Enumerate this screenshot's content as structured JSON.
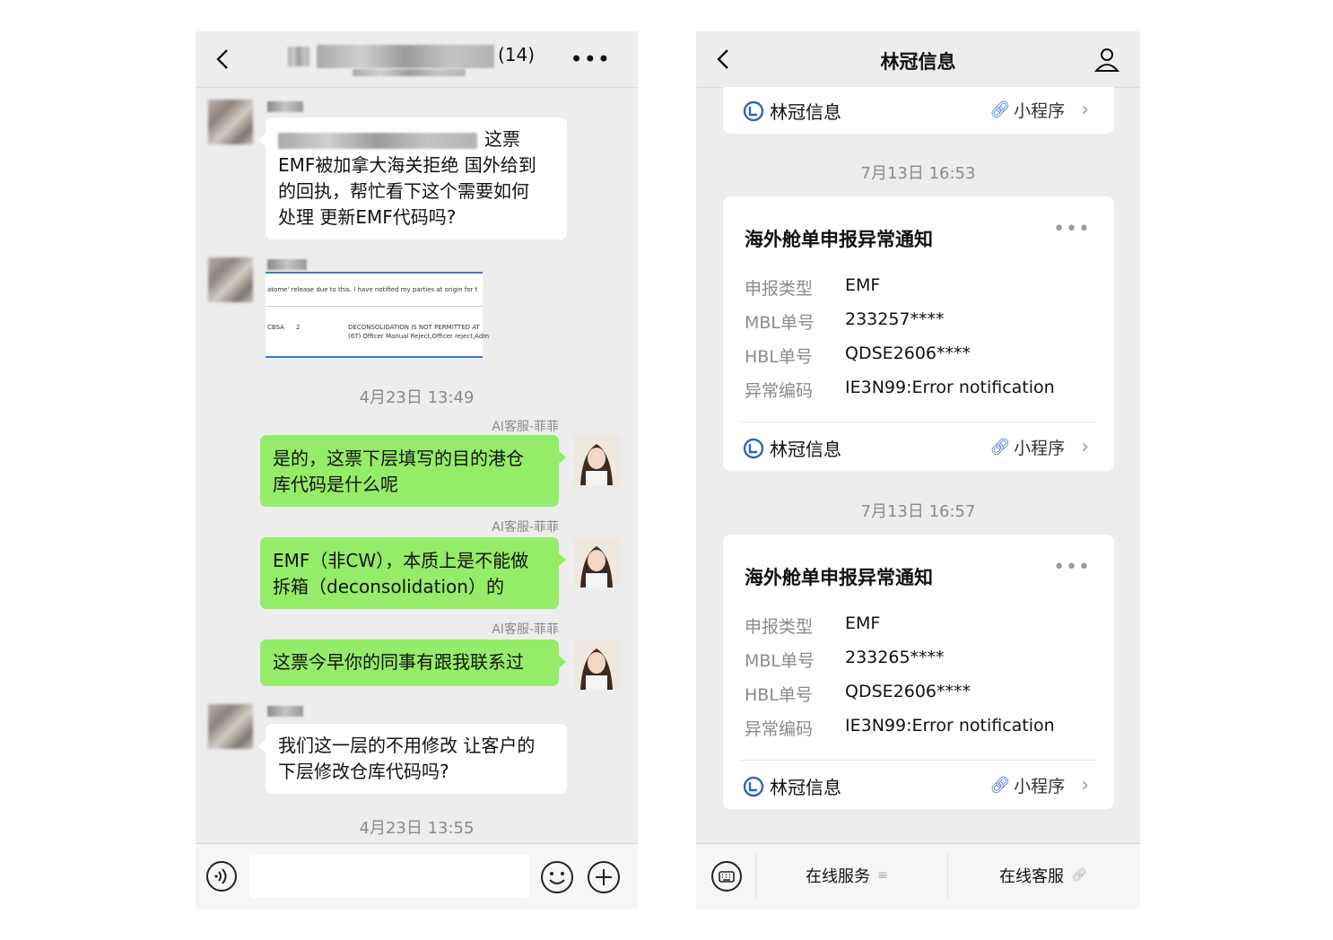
{
  "left": {
    "header": {
      "count": "(14)"
    },
    "messages": [
      {
        "type": "text-in",
        "text_lines": [
          "这票",
          "EMF被加拿大海关拒绝 国外给到",
          "的回执，帮忙看下这个需要如何",
          "处理 更新EMF代码吗?"
        ]
      },
      {
        "type": "image-in",
        "image_lines": [
          "atome' release due to this. I have notified my parties at origin for t",
          "CBSA",
          "2",
          "DECONSOLIDATION IS NOT PERMITTED AT",
          "(6T) Officer Manual Reject,Officer reject,Adm"
        ]
      },
      {
        "type": "time",
        "text": "4月23日 13:49"
      },
      {
        "type": "text-out",
        "sender": "AI客服-菲菲",
        "text_lines": [
          "是的，这票下层填写的目的港仓",
          "库代码是什么呢"
        ]
      },
      {
        "type": "text-out",
        "sender": "AI客服-菲菲",
        "text_lines": [
          "EMF（非CW），本质上是不能做",
          "拆箱（deconsolidation）的"
        ]
      },
      {
        "type": "text-out",
        "sender": "AI客服-菲菲",
        "text_lines": [
          "这票今早你的同事有跟我联系过"
        ]
      },
      {
        "type": "text-in",
        "text_lines": [
          "我们这一层的不用修改 让客户的",
          "下层修改仓库代码吗?"
        ]
      },
      {
        "type": "time",
        "text": "4月23日 13:55"
      }
    ]
  },
  "right": {
    "header": {
      "title": "林冠信息"
    },
    "top_card": {
      "brand": "林冠信息",
      "mini_label": "小程序"
    },
    "notices": [
      {
        "time": "7月13日 16:53",
        "title": "海外舱单申报异常通知",
        "rows": [
          {
            "label": "申报类型",
            "value": "EMF"
          },
          {
            "label": "MBL单号",
            "value": "233257****"
          },
          {
            "label": "HBL单号",
            "value": "QDSE2606****"
          },
          {
            "label": "异常编码",
            "value": "IE3N99:Error notification"
          }
        ],
        "brand": "林冠信息",
        "mini_label": "小程序"
      },
      {
        "time": "7月13日 16:57",
        "title": "海外舱单申报异常通知",
        "rows": [
          {
            "label": "申报类型",
            "value": "EMF"
          },
          {
            "label": "MBL单号",
            "value": "233265****"
          },
          {
            "label": "HBL单号",
            "value": "QDSE2606****"
          },
          {
            "label": "异常编码",
            "value": "IE3N99:Error notification"
          }
        ],
        "brand": "林冠信息",
        "mini_label": "小程序"
      }
    ],
    "bottom_bar": {
      "service_label": "在线服务",
      "support_label": "在线客服"
    }
  },
  "colors": {
    "bubble_green": "#95ec69",
    "link_blue": "#3a67d6",
    "brand_blue": "#2d63c8"
  },
  "icons": [
    "back-arrow-icon",
    "more-dots-icon",
    "voice-icon",
    "emoji-icon",
    "plus-icon",
    "profile-icon",
    "brand-logo-icon",
    "link-icon",
    "chevron-right-icon",
    "keyboard-icon",
    "menu-icon"
  ]
}
